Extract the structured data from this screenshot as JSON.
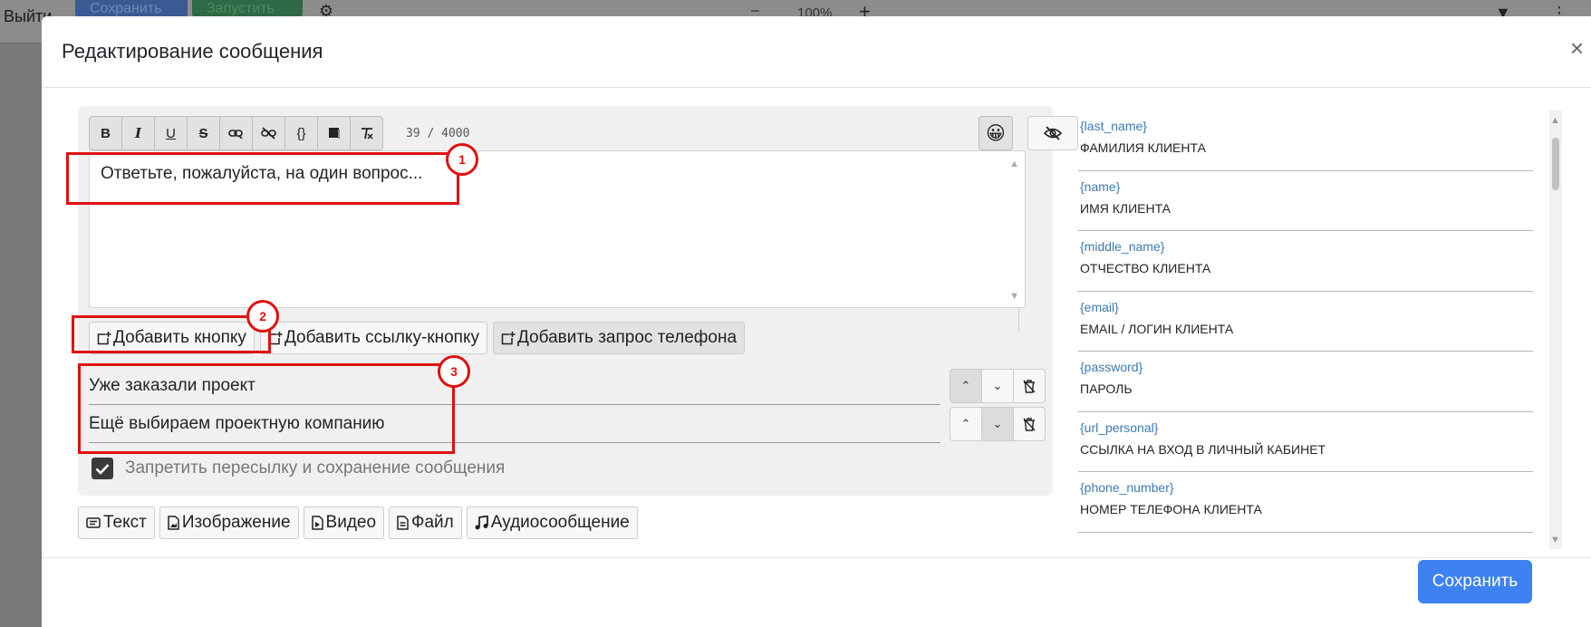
{
  "background": {
    "exit_label": "Выйти",
    "save_label": "Сохранить",
    "run_label": "Запустить",
    "zoom_minus": "−",
    "zoom_level": "100%",
    "zoom_plus": "+"
  },
  "modal": {
    "title": "Редактирование сообщения",
    "close": "×"
  },
  "editor": {
    "char_count": "39 / 4000",
    "text": "Ответьте, пожалуйста, на один вопрос...",
    "toolbar": [
      {
        "name": "bold",
        "label": "B"
      },
      {
        "name": "italic",
        "label": "I"
      },
      {
        "name": "underline",
        "label": "U"
      },
      {
        "name": "strikethrough",
        "label": "S"
      },
      {
        "name": "link",
        "label": ""
      },
      {
        "name": "unlink",
        "label": ""
      },
      {
        "name": "code",
        "label": "{}"
      },
      {
        "name": "spoiler",
        "label": ""
      },
      {
        "name": "clear-format",
        "label": ""
      }
    ]
  },
  "add_buttons": {
    "add_button": "Добавить кнопку",
    "add_link_button": "Добавить ссылку-кнопку",
    "add_phone_request": "Добавить запрос телефона"
  },
  "reply_buttons": [
    {
      "label": "Уже заказали проект"
    },
    {
      "label": "Ещё выбираем проектную компанию"
    }
  ],
  "forward_lock": {
    "label": "Запретить пересылку и сохранение сообщения",
    "checked": true
  },
  "type_buttons": {
    "text": "Текст",
    "image": "Изображение",
    "video": "Видео",
    "file": "Файл",
    "audio": "Аудиосообщение"
  },
  "variables": [
    {
      "code": "{last_name}",
      "desc": "ФАМИЛИЯ КЛИЕНТА"
    },
    {
      "code": "{name}",
      "desc": "ИМЯ КЛИЕНТА"
    },
    {
      "code": "{middle_name}",
      "desc": "ОТЧЕСТВО КЛИЕНТА"
    },
    {
      "code": "{email}",
      "desc": "EMAIL / ЛОГИН КЛИЕНТА"
    },
    {
      "code": "{password}",
      "desc": "ПАРОЛЬ"
    },
    {
      "code": "{url_personal}",
      "desc": "ССЫЛКА НА ВХОД В ЛИЧНЫЙ КАБИНЕТ"
    },
    {
      "code": "{phone_number}",
      "desc": "НОМЕР ТЕЛЕФОНА КЛИЕНТА"
    }
  ],
  "footer": {
    "save": "Сохранить"
  },
  "annotations": [
    "1",
    "2",
    "3"
  ],
  "colors": {
    "primary": "#3d82f0",
    "annotation_red": "#e01010",
    "variable_code": "#3c7ab5"
  }
}
